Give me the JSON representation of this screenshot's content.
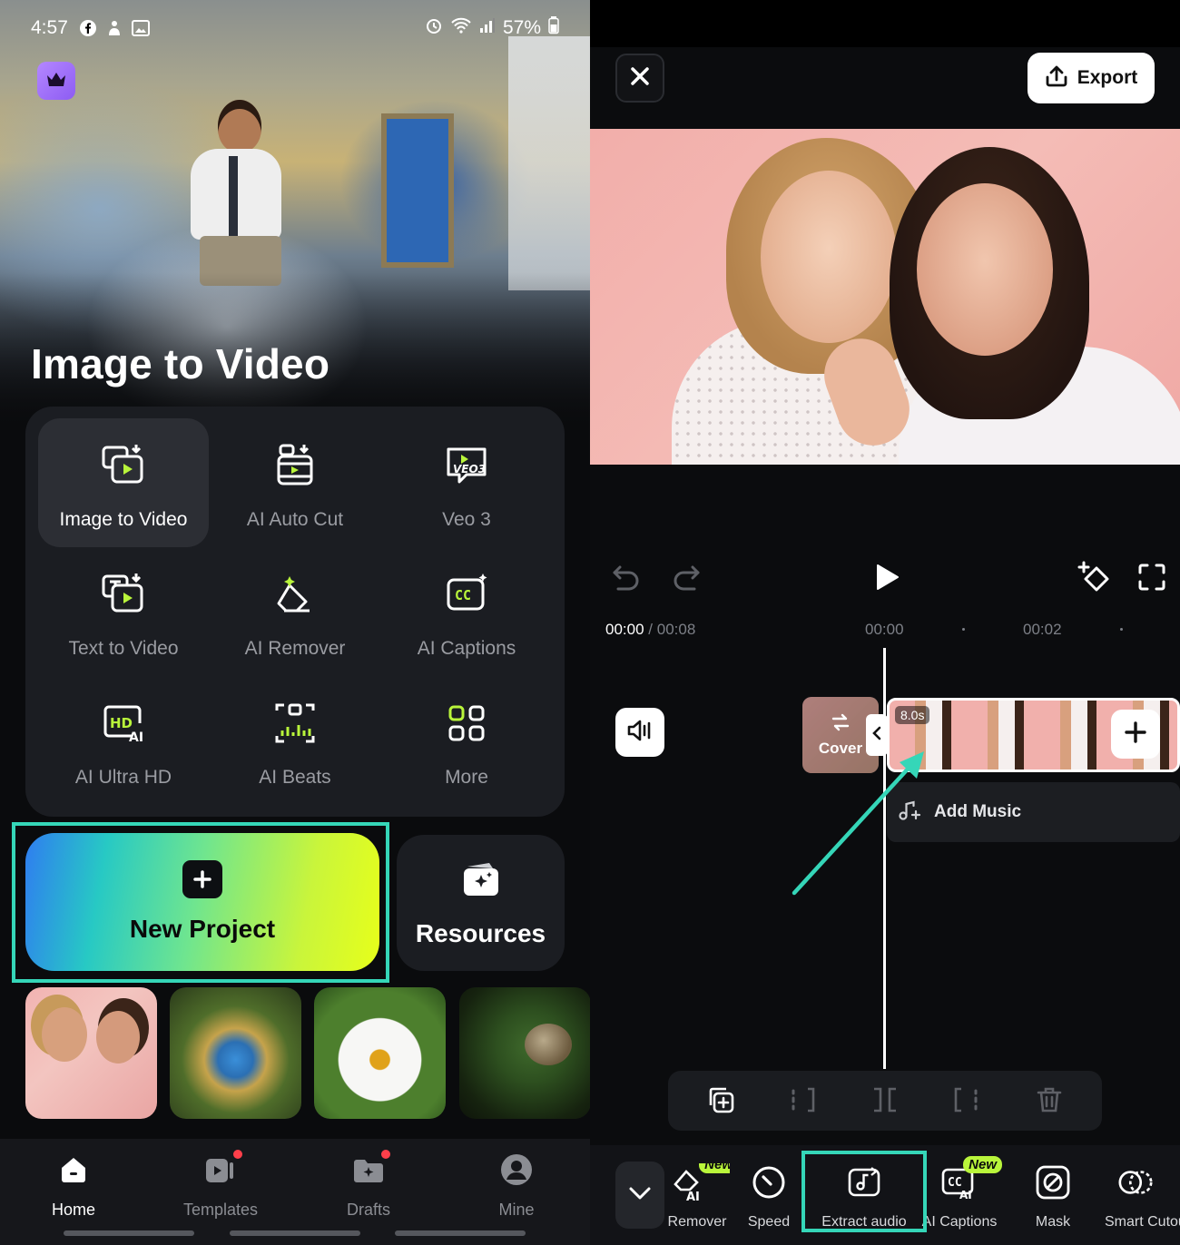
{
  "status_bar": {
    "time": "4:57",
    "battery": "57%"
  },
  "home": {
    "hero_title": "Image to Video",
    "tools": [
      {
        "label": "Image to Video",
        "icon": "image-to-video-icon",
        "active": true
      },
      {
        "label": "AI Auto Cut",
        "icon": "ai-auto-cut-icon"
      },
      {
        "label": "Veo 3",
        "icon": "veo3-icon"
      },
      {
        "label": "Text to Video",
        "icon": "text-to-video-icon"
      },
      {
        "label": "AI Remover",
        "icon": "ai-remover-icon"
      },
      {
        "label": "AI Captions",
        "icon": "ai-captions-icon"
      },
      {
        "label": "AI Ultra HD",
        "icon": "ai-ultra-hd-icon"
      },
      {
        "label": "AI Beats",
        "icon": "ai-beats-icon"
      },
      {
        "label": "More",
        "icon": "more-grid-icon"
      }
    ],
    "new_project_label": "New Project",
    "resources_label": "Resources",
    "nav": [
      {
        "label": "Home",
        "icon": "home-icon",
        "active": true
      },
      {
        "label": "Templates",
        "icon": "templates-icon",
        "badge": true
      },
      {
        "label": "Drafts",
        "icon": "drafts-icon",
        "badge": true
      },
      {
        "label": "Mine",
        "icon": "profile-icon"
      }
    ]
  },
  "editor": {
    "export_label": "Export",
    "current_time": "00:00",
    "total_time": "00:08",
    "ruler": [
      "00:00",
      "00:02"
    ],
    "clip_duration": "8.0s",
    "cover_label": "Cover",
    "add_music_label": "Add Music",
    "bottom_tools": [
      {
        "label": "Remover",
        "icon": "ai-remover-icon",
        "new": true
      },
      {
        "label": "Speed",
        "icon": "speed-icon"
      },
      {
        "label": "Extract audio",
        "icon": "extract-audio-icon",
        "highlighted": true
      },
      {
        "label": "AI Captions",
        "icon": "ai-captions-icon",
        "new": true
      },
      {
        "label": "Mask",
        "icon": "mask-icon"
      },
      {
        "label": "Smart Cutout",
        "icon": "smart-cutout-icon"
      }
    ],
    "new_badge": "New",
    "ai_badge": "AI",
    "accent_color": "#35d6b8"
  }
}
